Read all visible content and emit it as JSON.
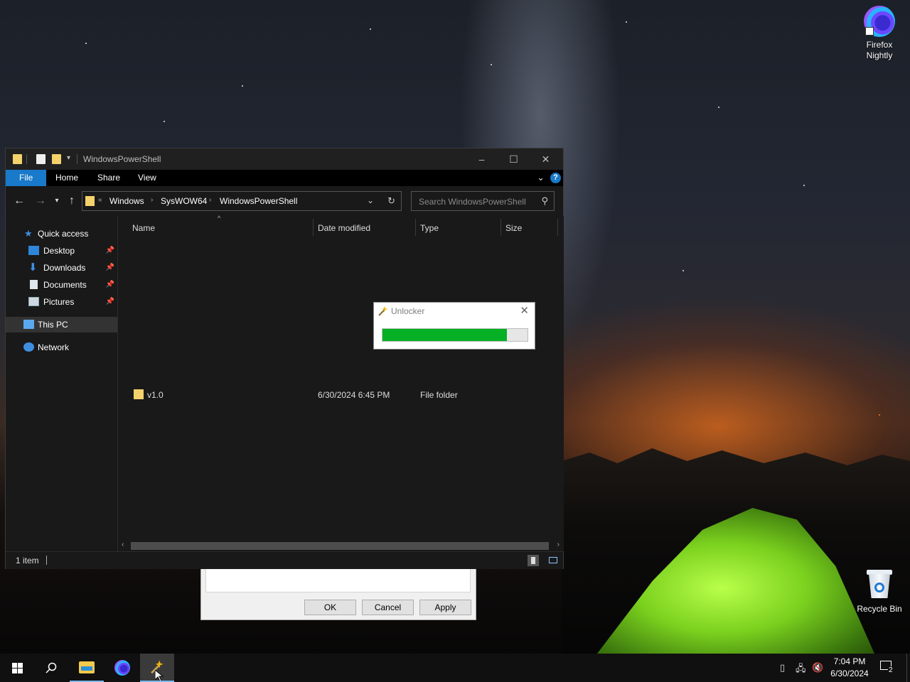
{
  "desktop": {
    "icons": [
      {
        "label": "Firefox Nightly"
      },
      {
        "label": "Recycle Bin"
      }
    ]
  },
  "explorer": {
    "title": "WindowsPowerShell",
    "ribbon_tabs": [
      "File",
      "Home",
      "Share",
      "View"
    ],
    "help_glyph": "?",
    "breadcrumb": [
      "Windows",
      "SysWOW64",
      "WindowsPowerShell"
    ],
    "search_placeholder": "Search WindowsPowerShell",
    "nav": {
      "quick_access": "Quick access",
      "desktop": "Desktop",
      "downloads": "Downloads",
      "documents": "Documents",
      "pictures": "Pictures",
      "this_pc": "This PC",
      "network": "Network"
    },
    "columns": {
      "name": "Name",
      "date": "Date modified",
      "type": "Type",
      "size": "Size"
    },
    "rows": [
      {
        "name": "v1.0",
        "date": "6/30/2024 6:45 PM",
        "type": "File folder",
        "size": ""
      }
    ],
    "status": "1 item"
  },
  "properties_dialog": {
    "ok_label": "OK",
    "cancel_label": "Cancel",
    "apply_label": "Apply"
  },
  "unlocker": {
    "title": "Unlocker",
    "progress_percent": 86
  },
  "taskbar": {
    "time": "7:04 PM",
    "date": "6/30/2024",
    "notification_count": "2"
  },
  "colors": {
    "accent_blue": "#1979ca",
    "progress_green": "#06b025",
    "folder_yellow": "#f4d26b"
  }
}
